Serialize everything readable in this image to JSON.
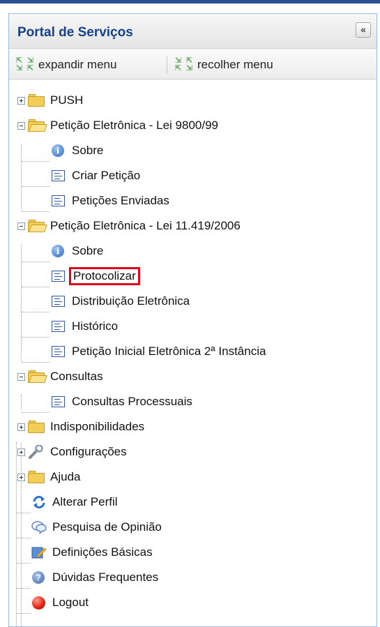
{
  "panel": {
    "title": "Portal de Serviços",
    "collapse_glyph": "«"
  },
  "toolbar": {
    "expand_label": "expandir menu",
    "collapse_label": "recolher menu"
  },
  "tree": {
    "push": "PUSH",
    "lei9800": "Petição Eletrônica - Lei 9800/99",
    "lei9800_items": [
      "Sobre",
      "Criar Petição",
      "Petições Enviadas"
    ],
    "lei11419": "Petição Eletrônica - Lei 11.419/2006",
    "lei11419_items": [
      "Sobre",
      "Protocolizar",
      "Distribuição Eletrônica",
      "Histórico",
      "Petição Inicial Eletrônica 2ª Instância"
    ],
    "consultas": "Consultas",
    "consultas_items": [
      "Consultas Processuais"
    ],
    "indisponibilidades": "Indisponibilidades",
    "configuracoes": "Configurações",
    "ajuda": "Ajuda",
    "leaves": [
      "Alterar Perfil",
      "Pesquisa de Opinião",
      "Definições Básicas",
      "Dúvidas Frequentes",
      "Logout"
    ]
  },
  "colors": {
    "title": "#15428b",
    "highlight": "#e0001b",
    "border": "#99bbe8"
  }
}
